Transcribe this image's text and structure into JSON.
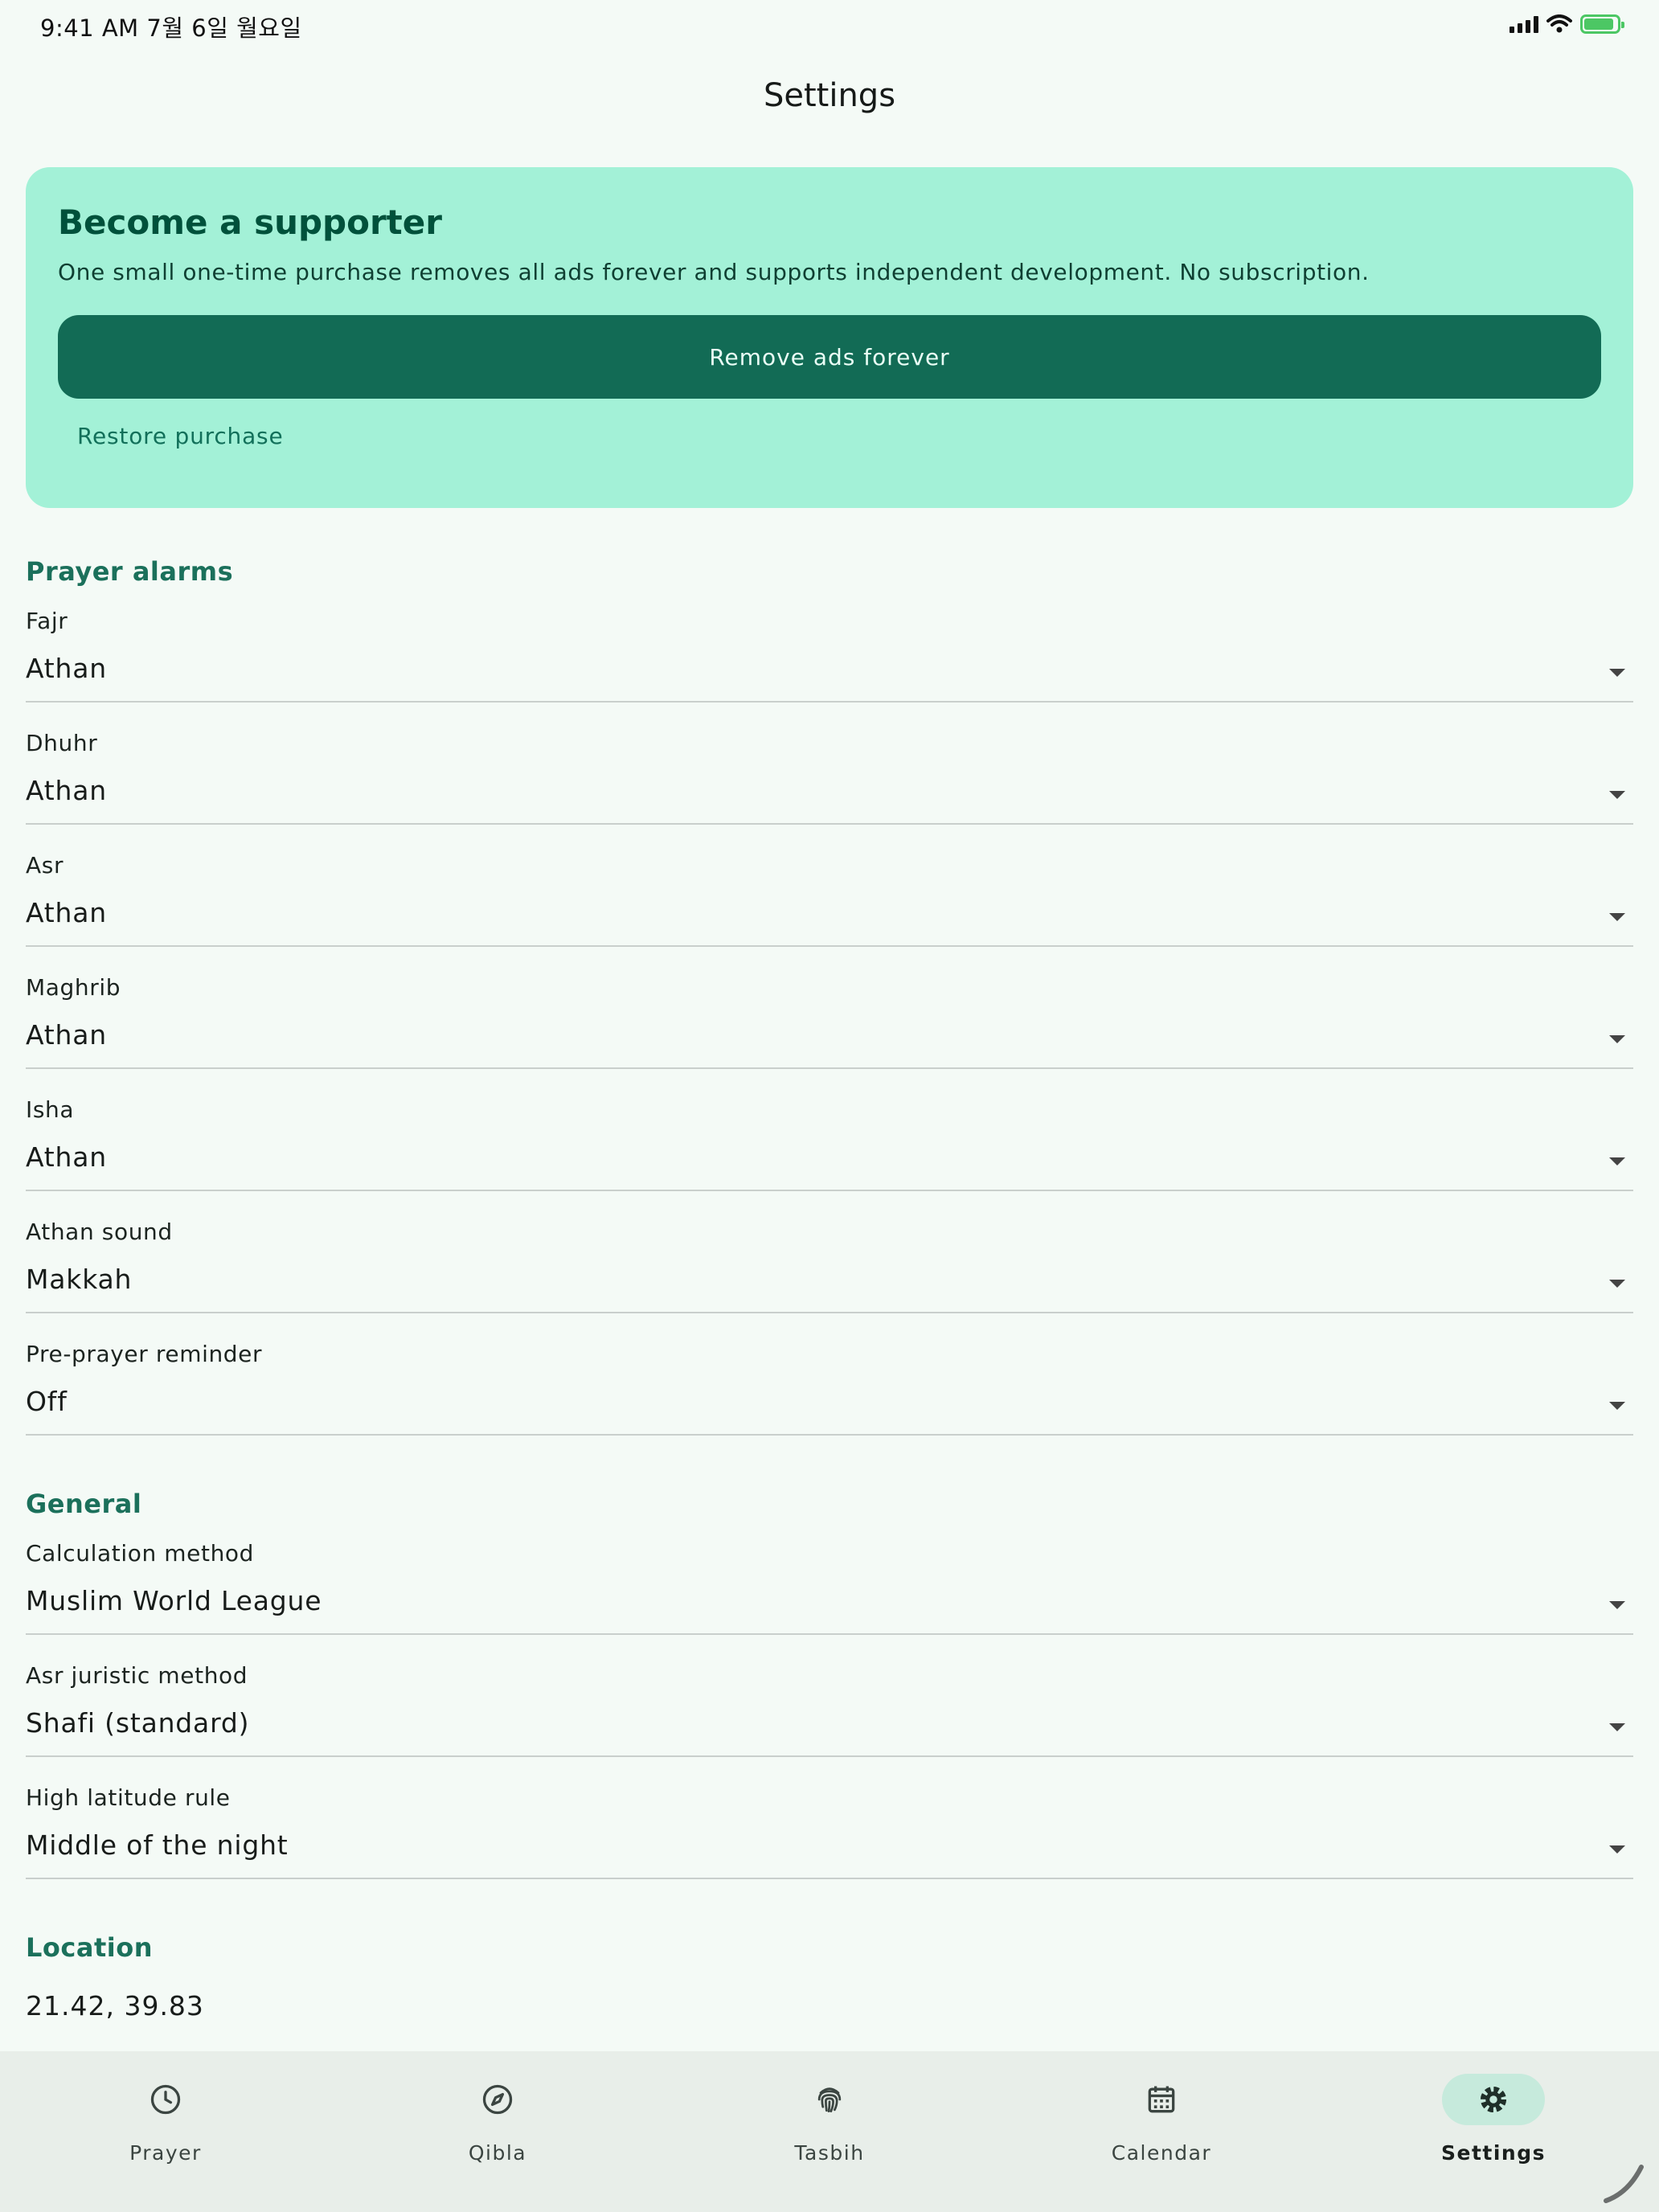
{
  "status_bar": {
    "time": "9:41 AM   7월 6일 월요일"
  },
  "header": {
    "title": "Settings"
  },
  "supporter": {
    "title": "Become a supporter",
    "description": "One small one-time purchase removes all ads forever and supports independent development. No subscription.",
    "primary_button": "Remove ads forever",
    "restore_button": "Restore purchase"
  },
  "prayer_alarms": {
    "section_title": "Prayer alarms",
    "fields": [
      {
        "label": "Fajr",
        "value": "Athan"
      },
      {
        "label": "Dhuhr",
        "value": "Athan"
      },
      {
        "label": "Asr",
        "value": "Athan"
      },
      {
        "label": "Maghrib",
        "value": "Athan"
      },
      {
        "label": "Isha",
        "value": "Athan"
      },
      {
        "label": "Athan sound",
        "value": "Makkah"
      },
      {
        "label": "Pre-prayer reminder",
        "value": "Off"
      }
    ]
  },
  "general": {
    "section_title": "General",
    "fields": [
      {
        "label": "Calculation method",
        "value": "Muslim World League"
      },
      {
        "label": "Asr juristic method",
        "value": "Shafi (standard)"
      },
      {
        "label": "High latitude rule",
        "value": "Middle of the night"
      }
    ]
  },
  "location": {
    "section_title": "Location",
    "value": "21.42, 39.83"
  },
  "nav": {
    "items": [
      {
        "label": "Prayer",
        "icon": "clock-icon"
      },
      {
        "label": "Qibla",
        "icon": "compass-icon"
      },
      {
        "label": "Tasbih",
        "icon": "fingerprint-icon"
      },
      {
        "label": "Calendar",
        "icon": "calendar-icon"
      },
      {
        "label": "Settings",
        "icon": "gear-icon",
        "active": true
      }
    ]
  },
  "colors": {
    "background": "#f4faf6",
    "card": "#a3f1d7",
    "primary": "#126b55",
    "section_title": "#1b705b",
    "nav_active_pill": "#c6eadc"
  }
}
